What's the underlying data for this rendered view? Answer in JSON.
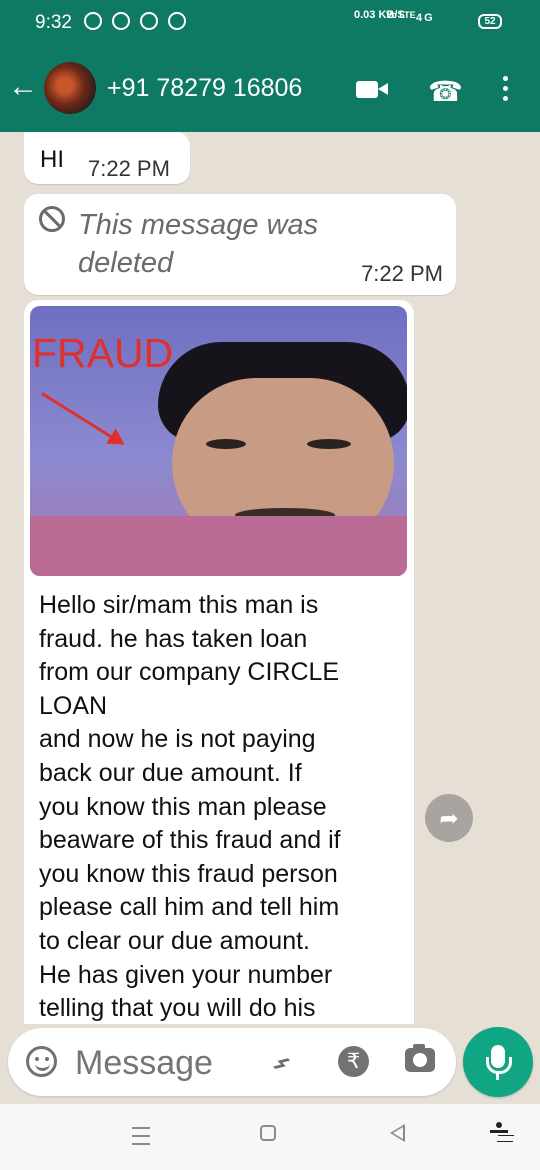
{
  "status_bar": {
    "time": "9:32",
    "network_speed": "0.03\nKB/S",
    "volte_label": "Vo\nLTE",
    "signal_text": "4G",
    "battery": "52"
  },
  "header": {
    "contact_name": "+91 78279 16806"
  },
  "messages": [
    {
      "text": "HI",
      "time": "7:22 PM"
    },
    {
      "text": "This message was deleted",
      "time": "7:22 PM"
    },
    {
      "text": "Hello sir/mam this man is\nfraud. he has taken loan\nfrom our company CIRCLE\nLOAN\nand now he is not paying\nback our due amount. If\nyou know this man please\nbeaware of this fraud and if\nyou know this fraud person\nplease call him and tell him\nto clear our due amount.\nHe has given your number\ntelling that you will do his",
      "image_label": "FRAUD"
    }
  ],
  "composer": {
    "placeholder": "Message"
  },
  "icons": {
    "back": "back-arrow-icon",
    "video": "video-call-icon",
    "call": "voice-call-icon",
    "menu": "more-options-icon",
    "emoji": "emoji-icon",
    "attach": "attachment-icon",
    "payment": "rupee-icon",
    "camera": "camera-icon",
    "mic": "microphone-icon",
    "forward": "forward-icon"
  },
  "colors": {
    "header": "#0f7a63",
    "mic_button": "#11a683",
    "chat_background": "#e6dfd6"
  }
}
